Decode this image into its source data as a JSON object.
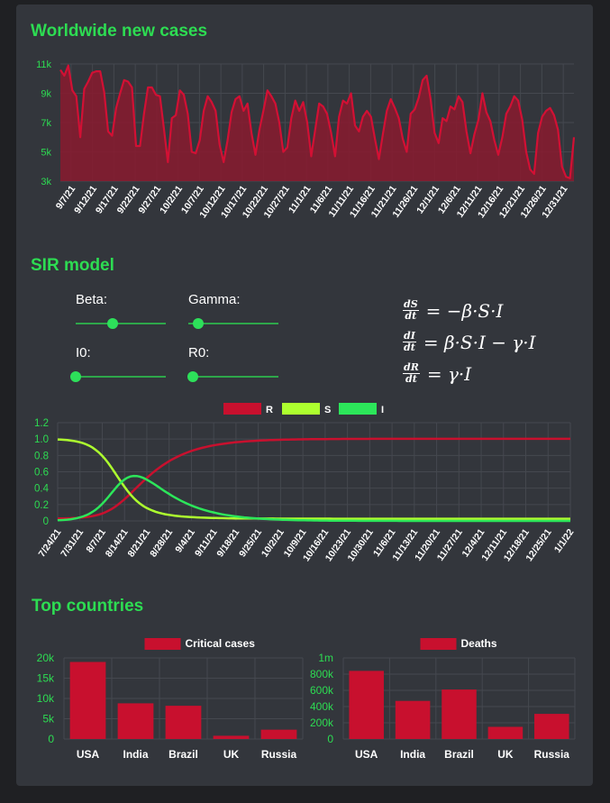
{
  "sections": {
    "worldwide_title": "Worldwide new cases",
    "sir_title": "SIR model",
    "top_title": "Top countries"
  },
  "sir_controls": {
    "beta_label": "Beta:",
    "beta_value": 0.41,
    "gamma_label": "Gamma:",
    "gamma_value": 0.11,
    "i0_label": "I0:",
    "i0_value": 0.0,
    "r0_label": "R0:",
    "r0_value": 0.05
  },
  "equations": {
    "eq1_num": "dS",
    "eq1_den": "dt",
    "eq1_rhs": "= −β·S·I",
    "eq2_num": "dI",
    "eq2_den": "dt",
    "eq2_rhs": "= β·S·I − γ·I",
    "eq3_num": "dR",
    "eq3_den": "dt",
    "eq3_rhs": "= γ·I"
  },
  "colors": {
    "accent": "#2ddc52",
    "cases_line": "#d21034",
    "cases_fill": "#8a1a2e",
    "R": "#c8102e",
    "S": "#adff2f",
    "I": "#2ce65a",
    "bar": "#c8102e",
    "grid": "#45484f",
    "tick_green": "#2ddc52"
  },
  "chart_data": [
    {
      "type": "area",
      "title": "Worldwide new cases",
      "x_ticks": [
        "9/7/21",
        "9/12/21",
        "9/17/21",
        "9/22/21",
        "9/27/21",
        "10/2/21",
        "10/7/21",
        "10/12/21",
        "10/17/21",
        "10/22/21",
        "10/27/21",
        "11/1/21",
        "11/6/21",
        "11/11/21",
        "11/16/21",
        "11/21/21",
        "11/26/21",
        "12/1/21",
        "12/6/21",
        "12/11/21",
        "12/16/21",
        "12/21/21",
        "12/26/21",
        "12/31/21"
      ],
      "y_ticks": [
        "3k",
        "5k",
        "7k",
        "9k",
        "11k"
      ],
      "ylim": [
        3000,
        11000
      ],
      "series": [
        {
          "values": [
            10600,
            10200,
            10900,
            9200,
            8800,
            6000,
            9300,
            9800,
            10400,
            10500,
            10500,
            9100,
            6400,
            6100,
            8000,
            9000,
            9900,
            9800,
            9400,
            5400,
            5400,
            7600,
            9400,
            9400,
            8900,
            8800,
            6600,
            4300,
            7300,
            7500,
            9200,
            8900,
            7600,
            5000,
            4900,
            5800,
            7800,
            8800,
            8400,
            7800,
            5500,
            4300,
            5800,
            7700,
            8600,
            8800,
            7800,
            8300,
            6300,
            4800,
            6500,
            7800,
            9200,
            8800,
            8300,
            7000,
            5000,
            5300,
            7300,
            8500,
            7800,
            8400,
            7000,
            4700,
            6500,
            8300,
            8100,
            7600,
            6300,
            4700,
            7400,
            8500,
            8300,
            9000,
            6800,
            6400,
            7400,
            7800,
            7400,
            5900,
            4500,
            6200,
            7800,
            8600,
            8000,
            7300,
            5900,
            5000,
            7600,
            7900,
            8700,
            9900,
            10200,
            8600,
            6300,
            5600,
            7300,
            7100,
            8100,
            7900,
            8800,
            8400,
            6400,
            4900,
            6200,
            7200,
            9000,
            7700,
            7100,
            5800,
            4800,
            6000,
            7600,
            8100,
            8800,
            8500,
            7200,
            5000,
            3800,
            3500,
            6300,
            7400,
            7800,
            8000,
            7500,
            6500,
            4000,
            3300,
            3200,
            6000
          ]
        }
      ]
    },
    {
      "type": "line",
      "x_ticks": [
        "7/24/21",
        "7/31/21",
        "8/7/21",
        "8/14/21",
        "8/21/21",
        "8/28/21",
        "9/4/21",
        "9/11/21",
        "9/18/21",
        "9/25/21",
        "10/2/21",
        "10/9/21",
        "10/16/21",
        "10/23/21",
        "10/30/21",
        "11/6/21",
        "11/13/21",
        "11/20/21",
        "11/27/21",
        "12/4/21",
        "12/11/21",
        "12/18/21",
        "12/25/21",
        "1/1/22"
      ],
      "y_ticks": [
        "0",
        "0.2",
        "0.4",
        "0.6",
        "0.8",
        "1.0",
        "1.2"
      ],
      "ylim": [
        0,
        1.2
      ],
      "legend": [
        "R",
        "S",
        "I"
      ],
      "legend_position": "top"
    },
    {
      "type": "bar",
      "legend": "Critical cases",
      "categories": [
        "USA",
        "India",
        "Brazil",
        "UK",
        "Russia"
      ],
      "values": [
        19000,
        8800,
        8200,
        800,
        2300
      ],
      "y_ticks": [
        "0",
        "5k",
        "10k",
        "15k",
        "20k"
      ],
      "ylim": [
        0,
        20000
      ]
    },
    {
      "type": "bar",
      "legend": "Deaths",
      "categories": [
        "USA",
        "India",
        "Brazil",
        "UK",
        "Russia"
      ],
      "values": [
        840000,
        470000,
        610000,
        150000,
        310000
      ],
      "y_ticks": [
        "0",
        "200k",
        "400k",
        "600k",
        "800k",
        "1m"
      ],
      "ylim": [
        0,
        1000000
      ]
    }
  ]
}
